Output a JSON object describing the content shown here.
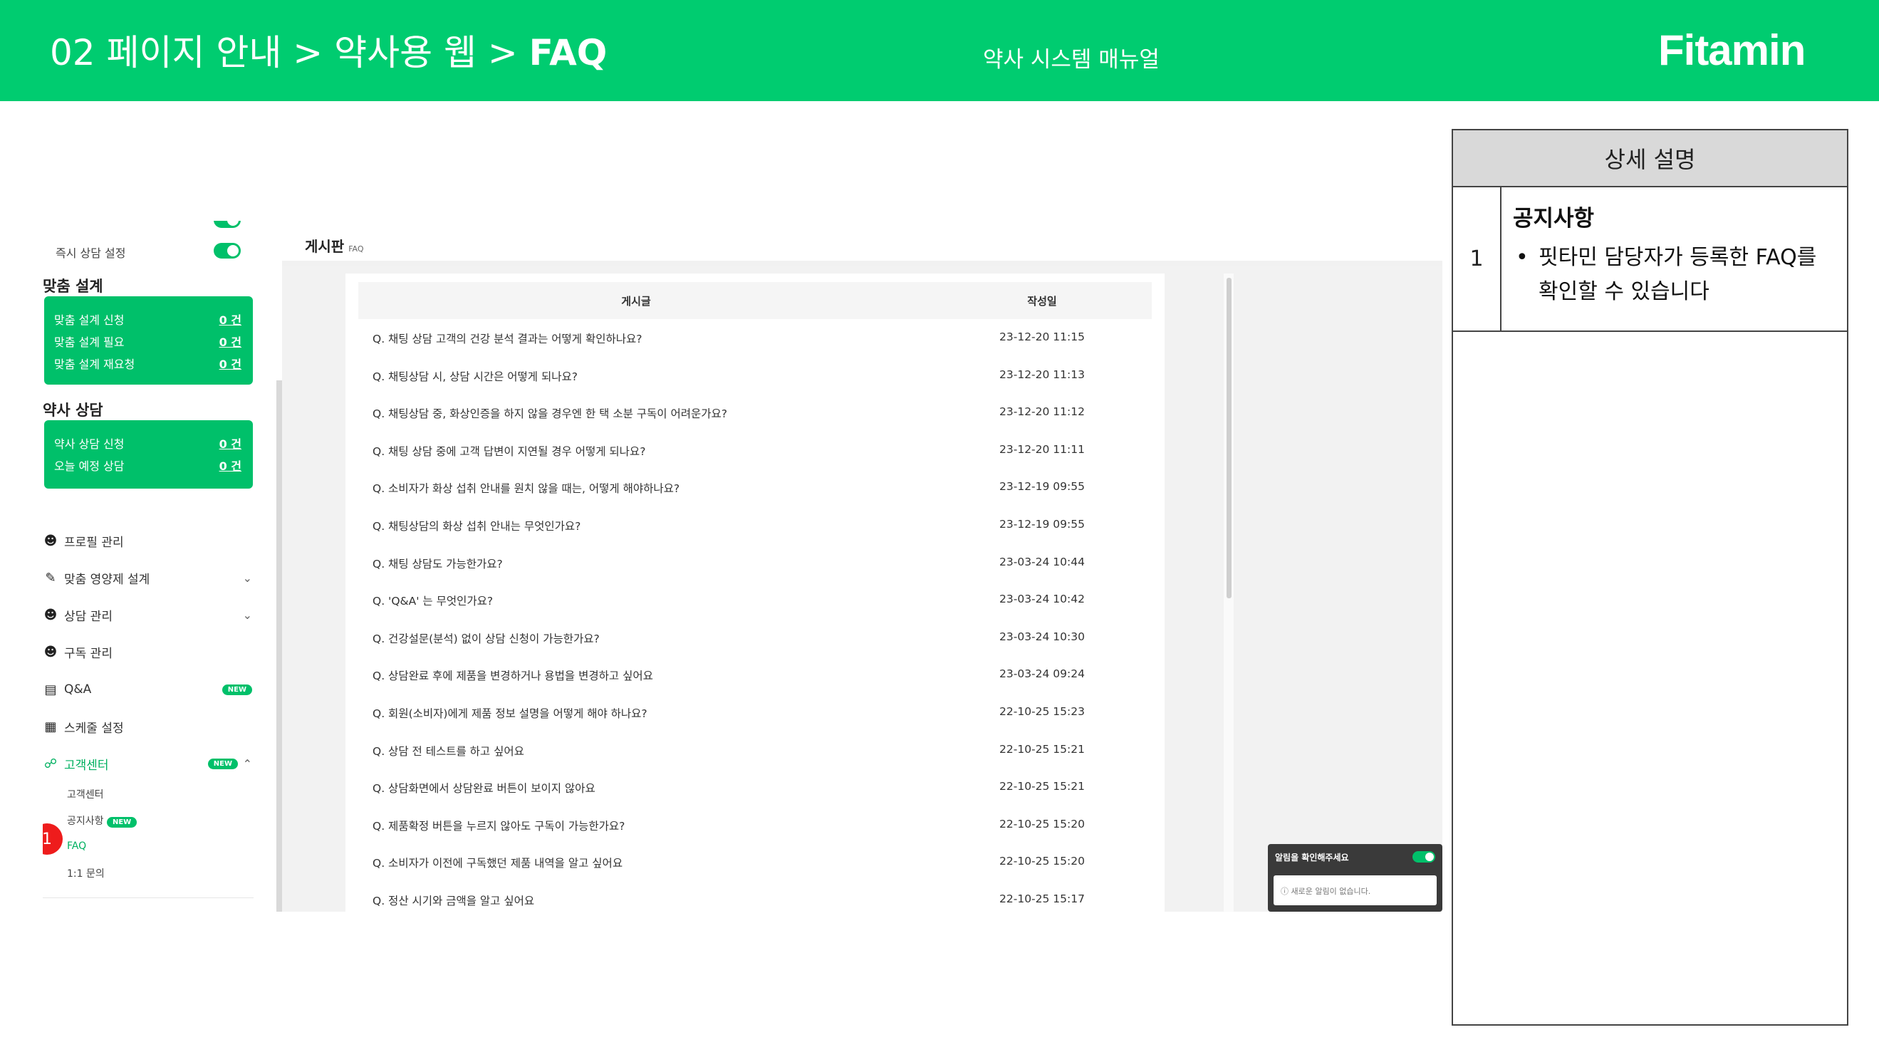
{
  "header": {
    "breadcrumb_prefix": "02 페이지 안내 > 약사용 웹 > ",
    "breadcrumb_current": "FAQ",
    "subtitle": "약사 시스템 매뉴얼",
    "logo": "Fitamin",
    "colors": {
      "banner": "#00cc70"
    }
  },
  "sidebar": {
    "top_cut_label": "— — — —",
    "instant_consult_label": "즉시 상담 설정",
    "custom_design": {
      "heading": "맞춤 설계",
      "rows": [
        {
          "label": "맞춤 설계 신청",
          "count": "0 건"
        },
        {
          "label": "맞춤 설계 필요",
          "count": "0 건"
        },
        {
          "label": "맞춤 설계 재요청",
          "count": "0 건"
        }
      ]
    },
    "pharmacist_consult": {
      "heading": "약사 상담",
      "rows": [
        {
          "label": "약사 상담 신청",
          "count": "0 건"
        },
        {
          "label": "오늘 예정 상담",
          "count": "0 건"
        }
      ]
    },
    "menu": {
      "profile": "프로필 관리",
      "nutrient": "맞춤 영양제 설계",
      "consult": "상담 관리",
      "subscription": "구독 관리",
      "qna": "Q&A",
      "schedule": "스케줄 설정",
      "support": "고객센터"
    },
    "new_badge": "NEW",
    "support_sub": {
      "center": "고객센터",
      "notice": "공지사항",
      "faq": "FAQ",
      "inquiry": "1:1 문의"
    },
    "marker": "1"
  },
  "board": {
    "title": "게시판",
    "tag": "FAQ",
    "columns": {
      "title": "게시글",
      "date": "작성일"
    },
    "rows": [
      {
        "title": "Q. 채팅 상담 고객의 건강 분석 결과는 어떻게 확인하나요?",
        "date": "23-12-20 11:15"
      },
      {
        "title": "Q. 채팅상담 시, 상담 시간은 어떻게 되나요?",
        "date": "23-12-20 11:13"
      },
      {
        "title": "Q. 채팅상담 중, 화상인증을 하지 않을 경우엔 한 택 소분 구독이 어려운가요?",
        "date": "23-12-20 11:12"
      },
      {
        "title": "Q. 채팅 상담 중에 고객 답변이 지연될 경우 어떻게 되나요?",
        "date": "23-12-20 11:11"
      },
      {
        "title": "Q. 소비자가 화상 섭취 안내를 원치 않을 때는, 어떻게 해야하나요?",
        "date": "23-12-19 09:55"
      },
      {
        "title": "Q. 채팅상담의 화상 섭취 안내는 무엇인가요?",
        "date": "23-12-19 09:55"
      },
      {
        "title": "Q. 채팅 상담도 가능한가요?",
        "date": "23-03-24 10:44"
      },
      {
        "title": "Q. 'Q&A' 는 무엇인가요?",
        "date": "23-03-24 10:42"
      },
      {
        "title": "Q. 건강설문(분석) 없이 상담 신청이 가능한가요?",
        "date": "23-03-24 10:30"
      },
      {
        "title": "Q. 상담완료 후에 제품을 변경하거나 용법을 변경하고 싶어요",
        "date": "23-03-24 09:24"
      },
      {
        "title": "Q. 회원(소비자)에게 제품 정보 설명을 어떻게 해야 하나요?",
        "date": "22-10-25 15:23"
      },
      {
        "title": "Q. 상담 전 테스트를 하고 싶어요",
        "date": "22-10-25 15:21"
      },
      {
        "title": "Q. 상담화면에서 상담완료 버튼이 보이지 않아요",
        "date": "22-10-25 15:21"
      },
      {
        "title": "Q. 제품확정 버튼을 누르지 않아도 구독이 가능한가요?",
        "date": "22-10-25 15:20"
      },
      {
        "title": "Q. 소비자가 이전에 구독했던 제품 내역을 알고 싶어요",
        "date": "22-10-25 15:20"
      },
      {
        "title": "Q. 정산 시기와 금액을 알고 싶어요",
        "date": "22-10-25 15:17"
      }
    ]
  },
  "notification": {
    "title": "알림을 확인해주세요",
    "empty_text": "새로운 알림이 없습니다."
  },
  "description": {
    "header": "상세 설명",
    "items": [
      {
        "number": "1",
        "title": "공지사항",
        "bullet": "핏타민 담당자가 등록한 FAQ를 확인할 수 있습니다"
      }
    ]
  }
}
